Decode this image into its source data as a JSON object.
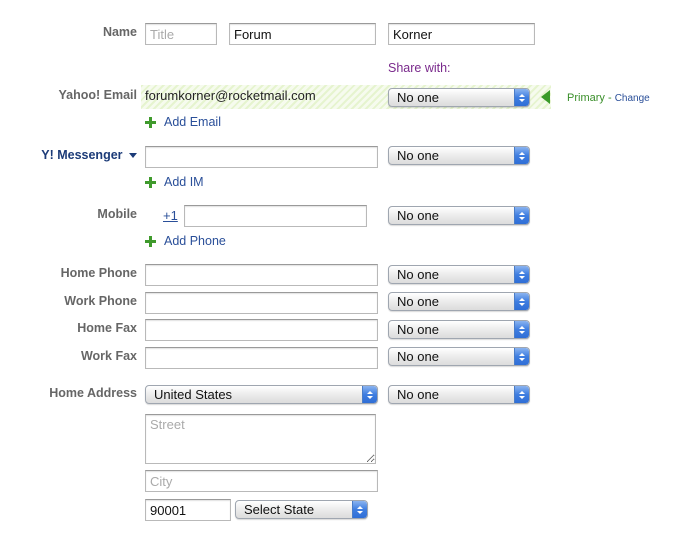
{
  "name": {
    "label": "Name",
    "title_placeholder": "Title",
    "first_value": "Forum",
    "last_value": "Korner"
  },
  "share_with_label": "Share with:",
  "email": {
    "label": "Yahoo! Email",
    "value": "forumkorner@rocketmail.com",
    "share": "No one",
    "primary_label": "Primary",
    "separator": "-",
    "change_label": "Change",
    "add_label": "Add Email"
  },
  "messenger": {
    "label": "Y! Messenger",
    "share": "No one",
    "add_label": "Add IM"
  },
  "mobile": {
    "label": "Mobile",
    "country_code": "+1",
    "share": "No one",
    "add_label": "Add Phone"
  },
  "home_phone": {
    "label": "Home Phone",
    "share": "No one"
  },
  "work_phone": {
    "label": "Work Phone",
    "share": "No one"
  },
  "home_fax": {
    "label": "Home Fax",
    "share": "No one"
  },
  "work_fax": {
    "label": "Work Fax",
    "share": "No one"
  },
  "address": {
    "label": "Home Address",
    "country": "United States",
    "share": "No one",
    "street_placeholder": "Street",
    "city_placeholder": "City",
    "zip_value": "90001",
    "state_select": "Select State"
  },
  "colors": {
    "label_gray": "#666666",
    "share_purple": "#7a2a8c",
    "primary_green": "#3a8f2a",
    "link_blue": "#2a4f99",
    "messenger_navy": "#1c3b78"
  }
}
